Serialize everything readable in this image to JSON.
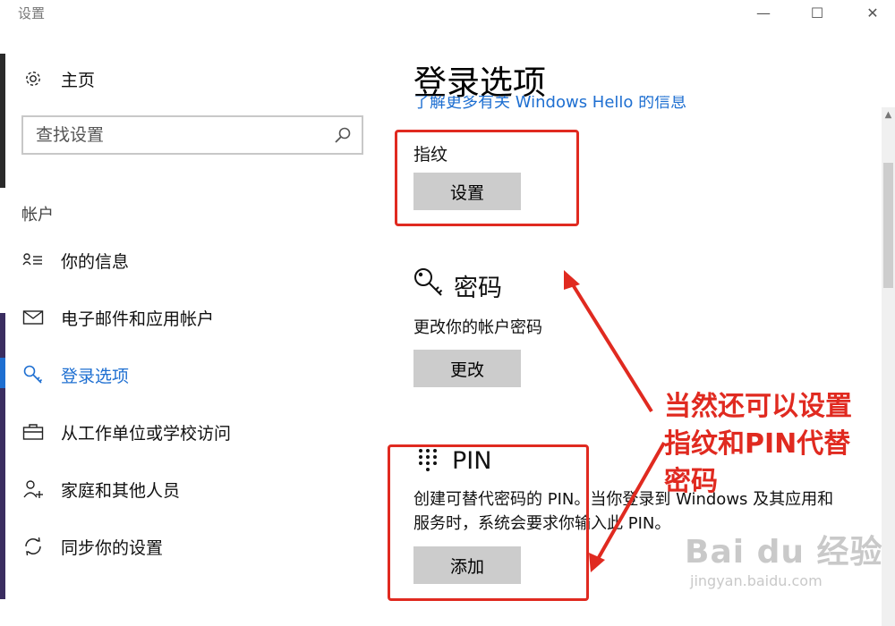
{
  "window": {
    "title": "设置"
  },
  "sidebar": {
    "home_label": "主页",
    "search_placeholder": "查找设置",
    "section_label": "帐户",
    "items": [
      {
        "label": "你的信息",
        "icon": "person-list-icon"
      },
      {
        "label": "电子邮件和应用帐户",
        "icon": "mail-icon"
      },
      {
        "label": "登录选项",
        "icon": "key-icon",
        "active": true
      },
      {
        "label": "从工作单位或学校访问",
        "icon": "briefcase-icon"
      },
      {
        "label": "家庭和其他人员",
        "icon": "person-add-icon"
      },
      {
        "label": "同步你的设置",
        "icon": "sync-icon"
      }
    ]
  },
  "main": {
    "title": "登录选项",
    "hello_link": "了解更多有关 Windows Hello 的信息",
    "fingerprint": {
      "label": "指纹",
      "button": "设置"
    },
    "password": {
      "title": "密码",
      "desc": "更改你的帐户密码",
      "button": "更改"
    },
    "pin": {
      "title": "PIN",
      "desc_line1": "创建可替代密码的 PIN。当你登录到 Windows 及其应用和",
      "desc_line2": "服务时，系统会要求你输入此 PIN。",
      "button": "添加"
    }
  },
  "annotation": {
    "line1": "当然还可以设置",
    "line2": "指纹和PIN代替",
    "line3": "密码"
  },
  "watermark": {
    "brand": "Bai du 经验",
    "url": "jingyan.baidu.com"
  },
  "colors": {
    "accent": "#1e6fd1",
    "annotation": "#e02a20",
    "button": "#cccccc"
  }
}
